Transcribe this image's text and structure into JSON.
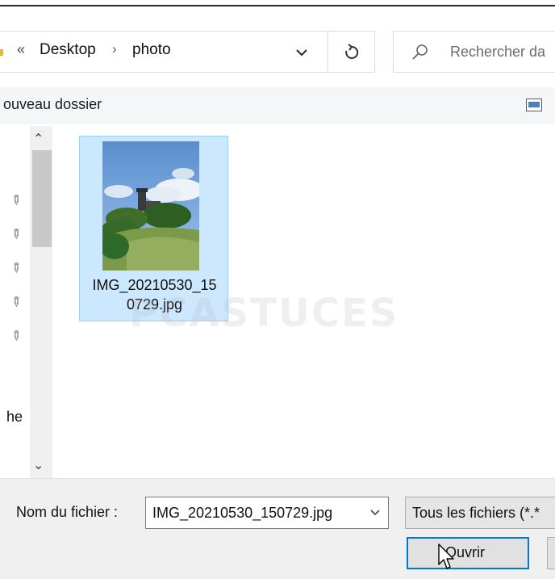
{
  "address_bar": {
    "segments": [
      "Desktop",
      "photo"
    ],
    "search_placeholder": "Rechercher da"
  },
  "toolbar": {
    "new_folder_label": "ouveau dossier"
  },
  "nav_pane": {
    "partial_label": "he"
  },
  "content": {
    "files": [
      {
        "name_line1": "IMG_20210530_15",
        "name_line2": "0729.jpg",
        "selected": true
      }
    ]
  },
  "watermark": "PCASTUCES",
  "bottom": {
    "file_name_label": "Nom du fichier :",
    "file_name_value": "IMG_20210530_150729.jpg",
    "file_type_value": "Tous les fichiers (*.*",
    "open_label": "Ouvrir"
  },
  "colors": {
    "selection_bg": "#cce8ff",
    "selection_border": "#99d1ff",
    "focus_border": "#0078d7"
  }
}
